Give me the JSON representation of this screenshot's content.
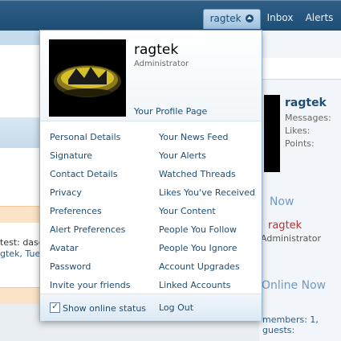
{
  "nav": {
    "user_tab": "ragtek",
    "inbox": "Inbox",
    "alerts": "Alerts"
  },
  "background": {
    "left_snippet_1": "test: dasd",
    "left_snippet_2": "gtek, Tues",
    "right_username": "ragtek",
    "right_messages": "Messages:",
    "right_likes": "Likes:",
    "right_points": "Points:",
    "staff_online_heading": "Now",
    "staff_name": "ragtek",
    "staff_title": "Administrator",
    "members_online_heading": "Online Now",
    "online_summary": "members: 1, guests:"
  },
  "menu": {
    "username": "ragtek",
    "user_title": "Administrator",
    "profile_link": "Your Profile Page",
    "left_column": [
      "Personal Details",
      "Signature",
      "Contact Details",
      "Privacy",
      "Preferences",
      "Alert Preferences",
      "Avatar",
      "Password",
      "Invite your friends"
    ],
    "right_column": [
      "Your News Feed",
      "Your Alerts",
      "Watched Threads",
      "Likes You've Received",
      "Your Content",
      "People You Follow",
      "People You Ignore",
      "Account Upgrades",
      "Linked Accounts"
    ],
    "show_online_status": "Show online status",
    "logout": "Log Out"
  }
}
